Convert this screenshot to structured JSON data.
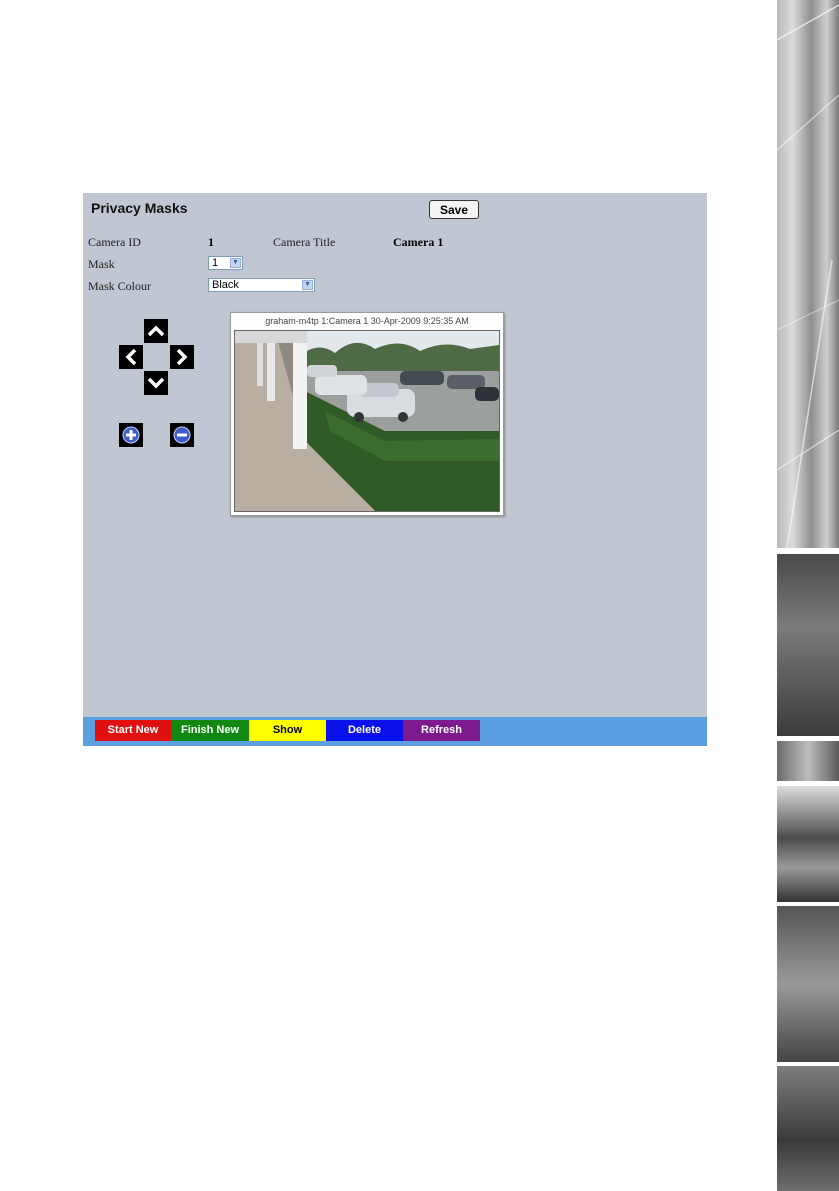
{
  "panel": {
    "title": "Privacy Masks",
    "save_label": "Save"
  },
  "form": {
    "camera_id_label": "Camera ID",
    "camera_id_value": "1",
    "camera_title_label": "Camera Title",
    "camera_title_value": "Camera 1",
    "mask_label": "Mask",
    "mask_value": "1",
    "mask_colour_label": "Mask Colour",
    "mask_colour_value": "Black"
  },
  "ptz": {
    "icons": [
      "chevron-up-icon",
      "chevron-left-icon",
      "chevron-right-icon",
      "chevron-down-icon",
      "zoom-in-icon",
      "zoom-out-icon"
    ]
  },
  "camera": {
    "caption": "graham-m4tp 1:Camera 1 30-Apr-2009 9:25:35 AM"
  },
  "toolbar": {
    "buttons": [
      {
        "label": "Start New",
        "color": "#e01010"
      },
      {
        "label": "Finish New",
        "color": "#118811"
      },
      {
        "label": "Show",
        "color": "#ffff00"
      },
      {
        "label": "Delete",
        "color": "#0a10e8"
      },
      {
        "label": "Refresh",
        "color": "#7d1a8e"
      }
    ],
    "bar_color": "#5a9fe0"
  },
  "colors": {
    "panel_bg": "#c0c7d3"
  }
}
